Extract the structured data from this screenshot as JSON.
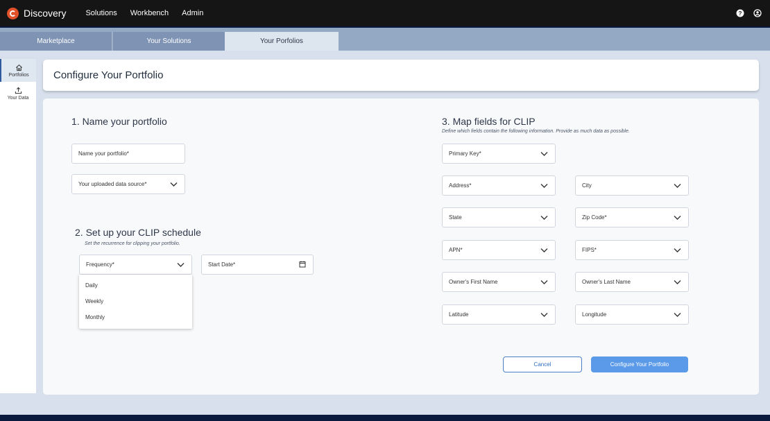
{
  "app": {
    "brand": "Discovery",
    "nav": [
      "Solutions",
      "Workbench",
      "Admin"
    ]
  },
  "tabs": [
    "Marketplace",
    "Your Solutions",
    "Your Porfolios"
  ],
  "sidebar": {
    "items": [
      {
        "label": "Portfolios",
        "icon": "home-icon"
      },
      {
        "label": "Your Data",
        "icon": "upload-icon"
      }
    ]
  },
  "page": {
    "title": "Configure Your Portfolio"
  },
  "section1": {
    "title": "1. Name your portfolio",
    "name_placeholder": "Name your portfolio*",
    "datasource_placeholder": "Your uploaded data source*"
  },
  "section2": {
    "title": "2. Set up your CLIP schedule",
    "subtitle": "Set the recurrence for clipping your portfolio.",
    "frequency_placeholder": "Frequency*",
    "start_date_placeholder": "Start Date*",
    "frequency_options": [
      "Daily",
      "Weekly",
      "Monthly"
    ]
  },
  "section3": {
    "title": "3. Map fields for CLIP",
    "subtitle": "Define which fields contain the following information. Provide as much data as possible.",
    "fields": {
      "primary_key": "Primary Key*",
      "address": "Address*",
      "city": "City",
      "state": "State",
      "zip": "Zip Code*",
      "apn": "APN*",
      "fips": "FIPS*",
      "owner_first": "Owner's First Name",
      "owner_last": "Owner's Last Name",
      "latitude": "Latitude",
      "longitude": "Longitude"
    }
  },
  "actions": {
    "cancel": "Cancel",
    "submit": "Configure Your Portfolio"
  },
  "colors": {
    "topbar": "#151515",
    "accent": "#5b9ae8",
    "brand": "#e2512a"
  }
}
